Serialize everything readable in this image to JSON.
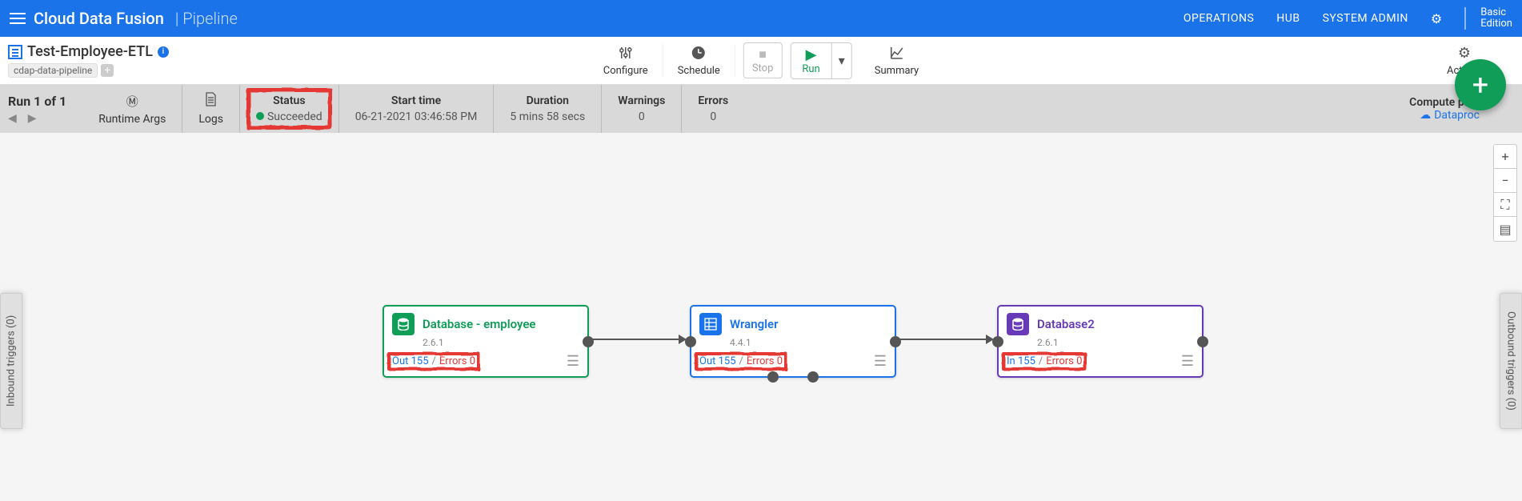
{
  "navbar": {
    "brand": "Cloud Data Fusion",
    "brand_sub": "Pipeline",
    "links": [
      "OPERATIONS",
      "HUB",
      "SYSTEM ADMIN"
    ],
    "edition_line1": "Basic",
    "edition_line2": "Edition"
  },
  "toolbar": {
    "title": "Test-Employee-ETL",
    "tag": "cdap-data-pipeline",
    "configure": "Configure",
    "schedule": "Schedule",
    "stop": "Stop",
    "run": "Run",
    "summary": "Summary",
    "actions": "Actions"
  },
  "runbar": {
    "run_label": "Run 1 of 1",
    "runtime_args": "Runtime Args",
    "logs": "Logs",
    "status_label": "Status",
    "status_value": "Succeeded",
    "start_label": "Start time",
    "start_value": "06-21-2021 03:46:58 PM",
    "duration_label": "Duration",
    "duration_value": "5 mins 58 secs",
    "warnings_label": "Warnings",
    "warnings_value": "0",
    "errors_label": "Errors",
    "errors_value": "0",
    "compute_label": "Compute profile",
    "compute_value": "Dataproc"
  },
  "triggers": {
    "inbound": "Inbound triggers (0)",
    "outbound": "Outbound triggers (0)"
  },
  "nodes": [
    {
      "title": "Database - employee",
      "version": "2.6.1",
      "stat_out_label": "Out",
      "stat_out": "155",
      "stat_err_label": "Errors",
      "stat_err": "0"
    },
    {
      "title": "Wrangler",
      "version": "4.4.1",
      "stat_out_label": "Out",
      "stat_out": "155",
      "stat_err_label": "Errors",
      "stat_err": "0"
    },
    {
      "title": "Database2",
      "version": "2.6.1",
      "stat_out_label": "In",
      "stat_out": "155",
      "stat_err_label": "Errors",
      "stat_err": "0"
    }
  ]
}
